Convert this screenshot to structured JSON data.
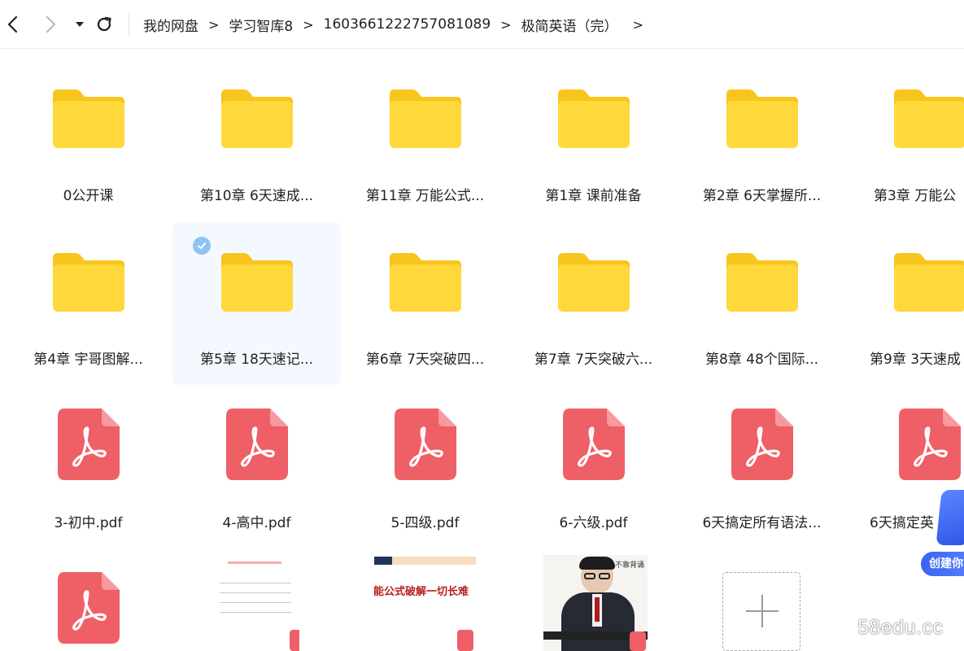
{
  "toolbar": {
    "back_icon": "chevron-left-icon",
    "forward_icon": "chevron-right-icon",
    "history_icon": "caret-down-icon",
    "refresh_icon": "refresh-icon"
  },
  "breadcrumb": {
    "items": [
      "我的网盘",
      "学习智库8",
      "1603661222757081089",
      "极简英语（完）"
    ],
    "separator": ">"
  },
  "files": {
    "row1": [
      "0公开课",
      "第10章 6天速成...",
      "第11章 万能公式...",
      "第1章 课前准备",
      "第2章 6天掌握所...",
      "第3章 万能公"
    ],
    "row2": [
      "第4章 宇哥图解...",
      "第5章 18天速记...",
      "第6章 7天突破四...",
      "第7章 7天突破六...",
      "第8章 48个国际...",
      "第9章 3天速成"
    ],
    "row3": [
      "3-初中.pdf",
      "4-高中.pdf",
      "5-四级.pdf",
      "6-六级.pdf",
      "6天搞定所有语法...",
      "6天搞定英"
    ]
  },
  "thumbs": {
    "doc2_title": "能公式破解一切长难",
    "doc3_side": "不靠背诵"
  },
  "promo": {
    "label": "创建你"
  },
  "watermark": "58edu.cc",
  "colors": {
    "folder": "#ffd83b",
    "folder_tab": "#f7c51c",
    "pdf": "#ef5f66",
    "selected_check": "#8fc2f2"
  }
}
